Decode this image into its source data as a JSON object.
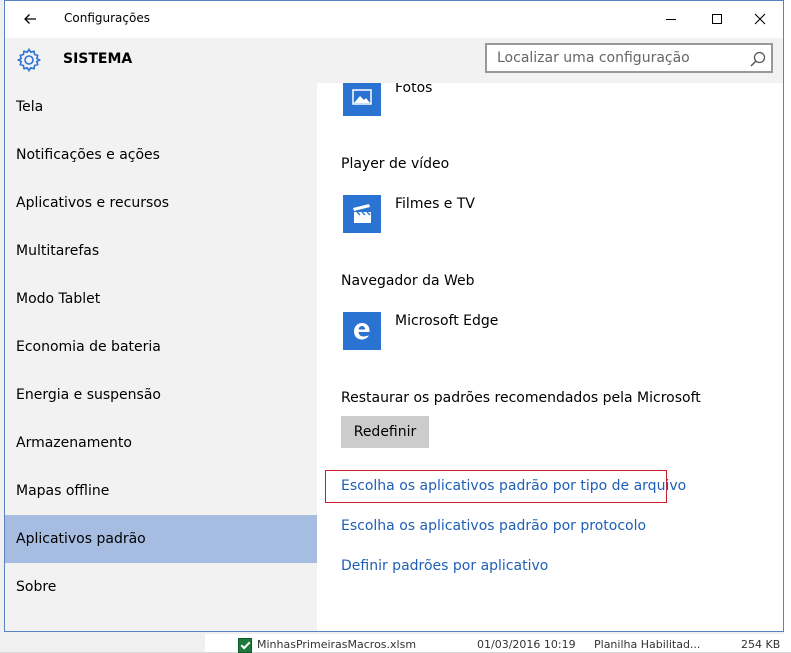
{
  "window": {
    "title": "Configurações",
    "section": "SISTEMA"
  },
  "search": {
    "placeholder": "Localizar uma configuração"
  },
  "sidebar": {
    "items": [
      {
        "label": "Tela"
      },
      {
        "label": "Notificações e ações"
      },
      {
        "label": "Aplicativos e recursos"
      },
      {
        "label": "Multitarefas"
      },
      {
        "label": "Modo Tablet"
      },
      {
        "label": "Economia de bateria"
      },
      {
        "label": "Energia e suspensão"
      },
      {
        "label": "Armazenamento"
      },
      {
        "label": "Mapas offline"
      },
      {
        "label": "Aplicativos padrão"
      },
      {
        "label": "Sobre"
      }
    ],
    "selected_index": 9
  },
  "content": {
    "photos_app": "Fotos",
    "video_label": "Player de vídeo",
    "video_app": "Filmes e TV",
    "web_label": "Navegador da Web",
    "web_app": "Microsoft Edge",
    "reset_label": "Restaurar os padrões recomendados pela Microsoft",
    "reset_button": "Redefinir",
    "links": [
      "Escolha os aplicativos padrão por tipo de arquivo",
      "Escolha os aplicativos padrão por protocolo",
      "Definir padrões por aplicativo"
    ]
  },
  "background_file": {
    "name": "MinhasPrimeirasMacros.xlsm",
    "date": "01/03/2016 10:19",
    "type": "Planilha Habilitad...",
    "size": "254 KB"
  },
  "colors": {
    "accent": "#2b73d3",
    "link": "#1f5fb6",
    "selected": "#a6bde1",
    "highlight": "#c8202a"
  },
  "icons": {
    "back": "back-arrow-icon",
    "gear": "gear-icon",
    "search": "search-icon",
    "photos": "photos-icon",
    "video": "film-clapper-icon",
    "edge": "edge-icon"
  }
}
